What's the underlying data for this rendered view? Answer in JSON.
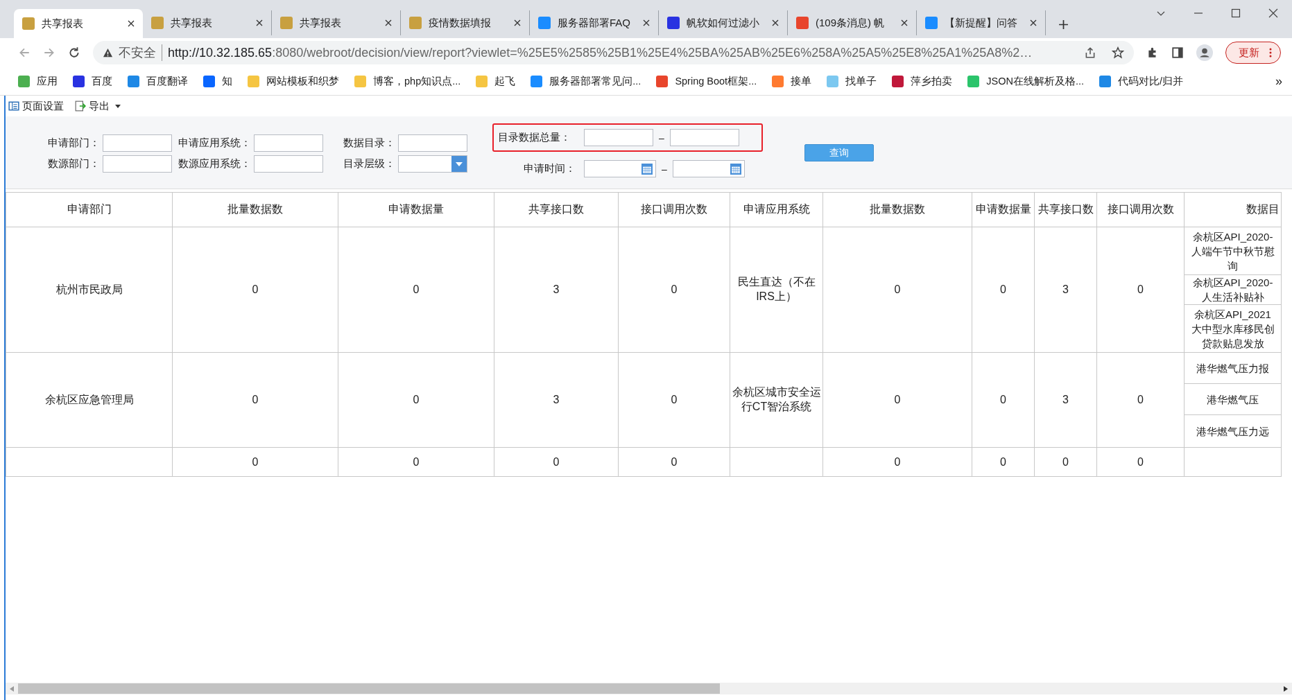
{
  "browser": {
    "tabs": [
      {
        "title": "共享报表",
        "selected": true
      },
      {
        "title": "共享报表",
        "selected": false
      },
      {
        "title": "共享报表",
        "selected": false
      },
      {
        "title": "疫情数据填报",
        "selected": false
      },
      {
        "title": "服务器部署FAQ",
        "selected": false
      },
      {
        "title": "帆软如何过滤小",
        "selected": false
      },
      {
        "title": "(109条消息) 帆",
        "selected": false
      },
      {
        "title": "【新提醒】问答",
        "selected": false
      }
    ],
    "address": {
      "security": "不安全",
      "host": "http://10.32.185.65",
      "path": ":8080/webroot/decision/view/report?viewlet=%25E5%2585%25B1%25E4%25BA%25AB%25E6%258A%25A5%25E8%25A1%25A8%2…"
    },
    "update_button": "更新",
    "bookmarks": [
      "应用",
      "百度",
      "百度翻译",
      "知",
      "网站模板和织梦",
      "博客，php知识点...",
      "起飞",
      "服务器部署常见问...",
      "Spring Boot框架...",
      "接单",
      "找单子",
      "萍乡拍卖",
      "JSON在线解析及格...",
      "代码对比/归并"
    ],
    "bookmarks_overflow": "»"
  },
  "report_toolbar": [
    {
      "label": "页面设置",
      "kind": "layout"
    },
    {
      "label": "导出",
      "kind": "export"
    }
  ],
  "filters": {
    "rows": [
      [
        {
          "label": "申请部门：",
          "kind": "text"
        },
        {
          "label": "申请应用系统：",
          "kind": "text"
        },
        {
          "label": "数据目录：",
          "kind": "text"
        }
      ],
      [
        {
          "label": "数源部门：",
          "kind": "text"
        },
        {
          "label": "数源应用系统：",
          "kind": "text"
        },
        {
          "label": "目录层级：",
          "kind": "select"
        }
      ]
    ],
    "ranges": [
      {
        "label": "目录数据总量：",
        "kind": "text",
        "separator": "–",
        "highlighted": true
      },
      {
        "label": "申请时间：",
        "kind": "date",
        "separator": "–",
        "highlighted": false
      }
    ],
    "query_button": "查询"
  },
  "table": {
    "columns": [
      "申请部门",
      "批量数据数",
      "申请数据量",
      "共享接口数",
      "接口调用次数",
      "申请应用系统",
      "批量数据数",
      "申请数据量",
      "共享接口数",
      "接口调用次数",
      "数据目"
    ],
    "rows": [
      {
        "cells": [
          "杭州市民政局",
          "0",
          "0",
          "3",
          "0",
          "民生直达（不在IRS上）",
          "0",
          "0",
          "3",
          "0"
        ],
        "catalog": [
          [
            "余杭区API_2020-",
            "人端午节中秋节慰",
            "询"
          ],
          [
            "余杭区API_2020-",
            "人生活补贴补"
          ],
          [
            "余杭区API_2021",
            "大中型水库移民创",
            "贷款贴息发放"
          ]
        ]
      },
      {
        "cells": [
          "余杭区应急管理局",
          "0",
          "0",
          "3",
          "0",
          "余杭区城市安全运行CT智治系统",
          "0",
          "0",
          "3",
          "0"
        ],
        "catalog": [
          [
            "港华燃气压力报"
          ],
          [
            "港华燃气压"
          ],
          [
            "港华燃气压力远"
          ]
        ]
      }
    ],
    "total": [
      "0",
      "0",
      "0",
      "0",
      "0",
      "0",
      "0",
      "0"
    ]
  }
}
